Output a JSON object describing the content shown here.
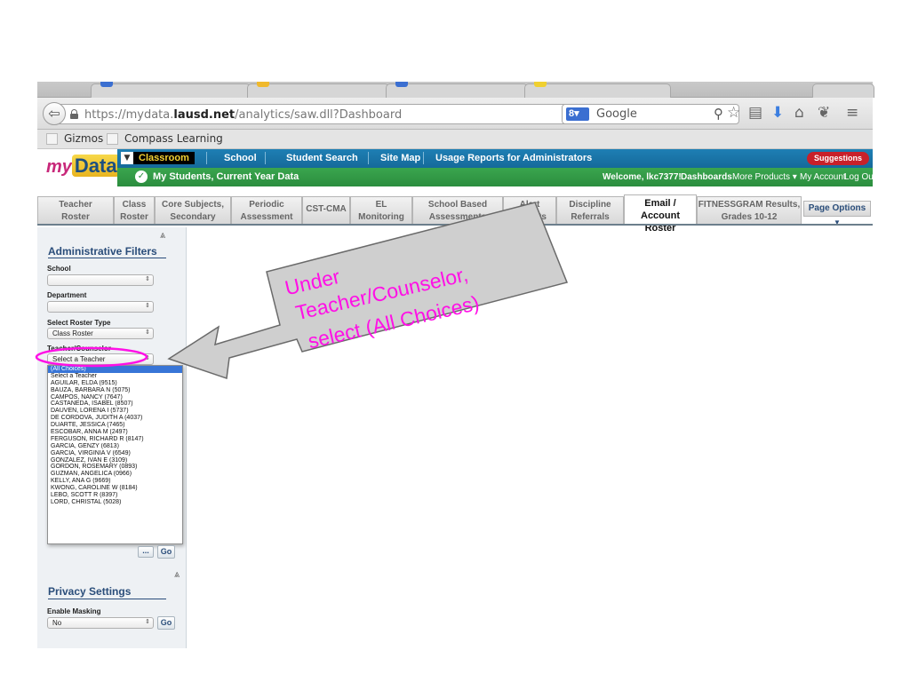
{
  "browser": {
    "url_prefix": "https://mydata.",
    "url_domain": "lausd.net",
    "url_path": "/analytics/saw.dll?Dashboard",
    "search_engine": "Google",
    "bookmarks": [
      "Gizmos",
      "Compass Learning"
    ]
  },
  "header": {
    "logo_my": "my",
    "logo_data": "Data",
    "classroom_label": "Classroom",
    "nav": [
      "School",
      "Student Search",
      "Site Map",
      "Usage Reports for Administrators"
    ],
    "suggestions": "Suggestions",
    "subnav_title": "My Students, Current Year Data",
    "welcome": "Welcome, lkc7377!",
    "dashboards": "Dashboards",
    "more_products": "More Products ▾",
    "my_account": "My Account",
    "log_out": "Log Out"
  },
  "tabs": [
    "Teacher\nRoster",
    "Class\nRoster",
    "Core Subjects,\nSecondary",
    "Periodic\nAssessment",
    "CST-CMA",
    "EL\nMonitoring",
    "School Based\nAssessments",
    "Alert\nReports",
    "Discipline\nReferrals",
    "Email /\nAccount Roster",
    "FITNESSGRAM Results,\nGrades 10-12"
  ],
  "page_options": "Page Options",
  "filters": {
    "title": "Administrative Filters",
    "school_label": "School",
    "school_value": "",
    "department_label": "Department",
    "department_value": "",
    "roster_type_label": "Select Roster Type",
    "roster_type_value": "Class Roster",
    "teacher_label": "Teacher/Counselor",
    "teacher_value": "Select a Teacher",
    "teacher_options": [
      "(All Choices)",
      "Select a Teacher",
      "AGUILAR, ELDA (9515)",
      "BAUZA, BARBARA N (5075)",
      "CAMPOS, NANCY (7647)",
      "CASTANEDA, ISABEL (8507)",
      "DAUVEN, LORENA I (5737)",
      "DE CORDOVA, JUDITH A (4037)",
      "DUARTE, JESSICA (7465)",
      "ESCOBAR, ANNA M (2497)",
      "FERGUSON, RICHARD R (8147)",
      "GARCIA, GENZY (6813)",
      "GARCIA, VIRGINIA V (6549)",
      "GONZALEZ, IVAN E (3109)",
      "GORDON, ROSEMARY (0893)",
      "GUZMAN, ANGELICA (0966)",
      "KELLY, ANA G (9669)",
      "KWONG, CAROLINE W (8184)",
      "LEBO, SCOTT R (8397)",
      "LORD, CHRISTAL (5028)"
    ],
    "dots_label": "...",
    "go_label": "Go"
  },
  "privacy": {
    "title": "Privacy Settings",
    "masking_label": "Enable Masking",
    "masking_value": "No",
    "go_label": "Go"
  },
  "annotation": {
    "text_lines": [
      "Under",
      "Teacher/Counselor,",
      "select (All Choices)"
    ],
    "color": "#ff10e6"
  },
  "colors": {
    "topnav": "#1e7fb4",
    "subnav": "#3aa54e",
    "filter_title": "#2a4d7a",
    "selection": "#3875d7"
  }
}
